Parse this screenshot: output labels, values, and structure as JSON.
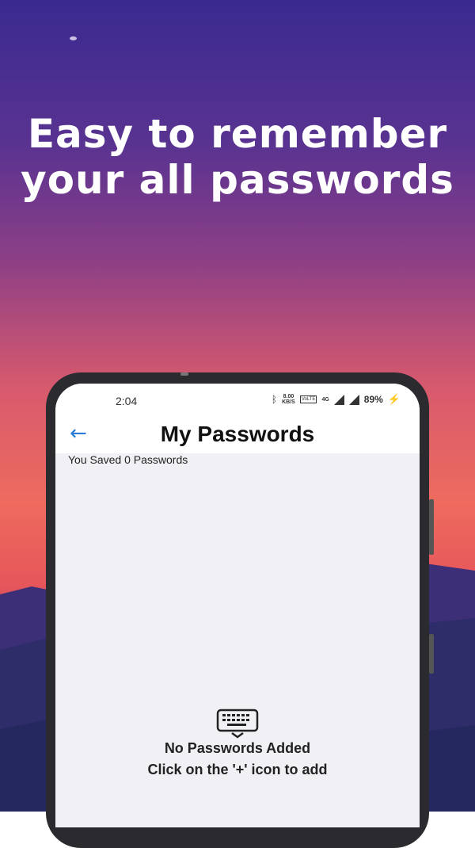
{
  "promo": {
    "headline_line1": "Easy to remember",
    "headline_line2": "your all passwords"
  },
  "status_bar": {
    "time": "2:04",
    "net_speed_top": "8.00",
    "net_speed_bottom": "KB/S",
    "volte": "VoLTE",
    "network": "4G",
    "battery": "89%",
    "icons": [
      "bluetooth-icon",
      "signal-icon",
      "charging-icon"
    ]
  },
  "app_bar": {
    "title": "My Passwords",
    "back_icon": "arrow-left-icon",
    "back_glyph": "←",
    "accent": "#2a7bd6"
  },
  "content": {
    "saved_count_text": "You Saved 0 Passwords",
    "empty_title": "No Passwords Added",
    "empty_hint": "Click on the '+' icon to add",
    "empty_icon": "keyboard-icon"
  }
}
